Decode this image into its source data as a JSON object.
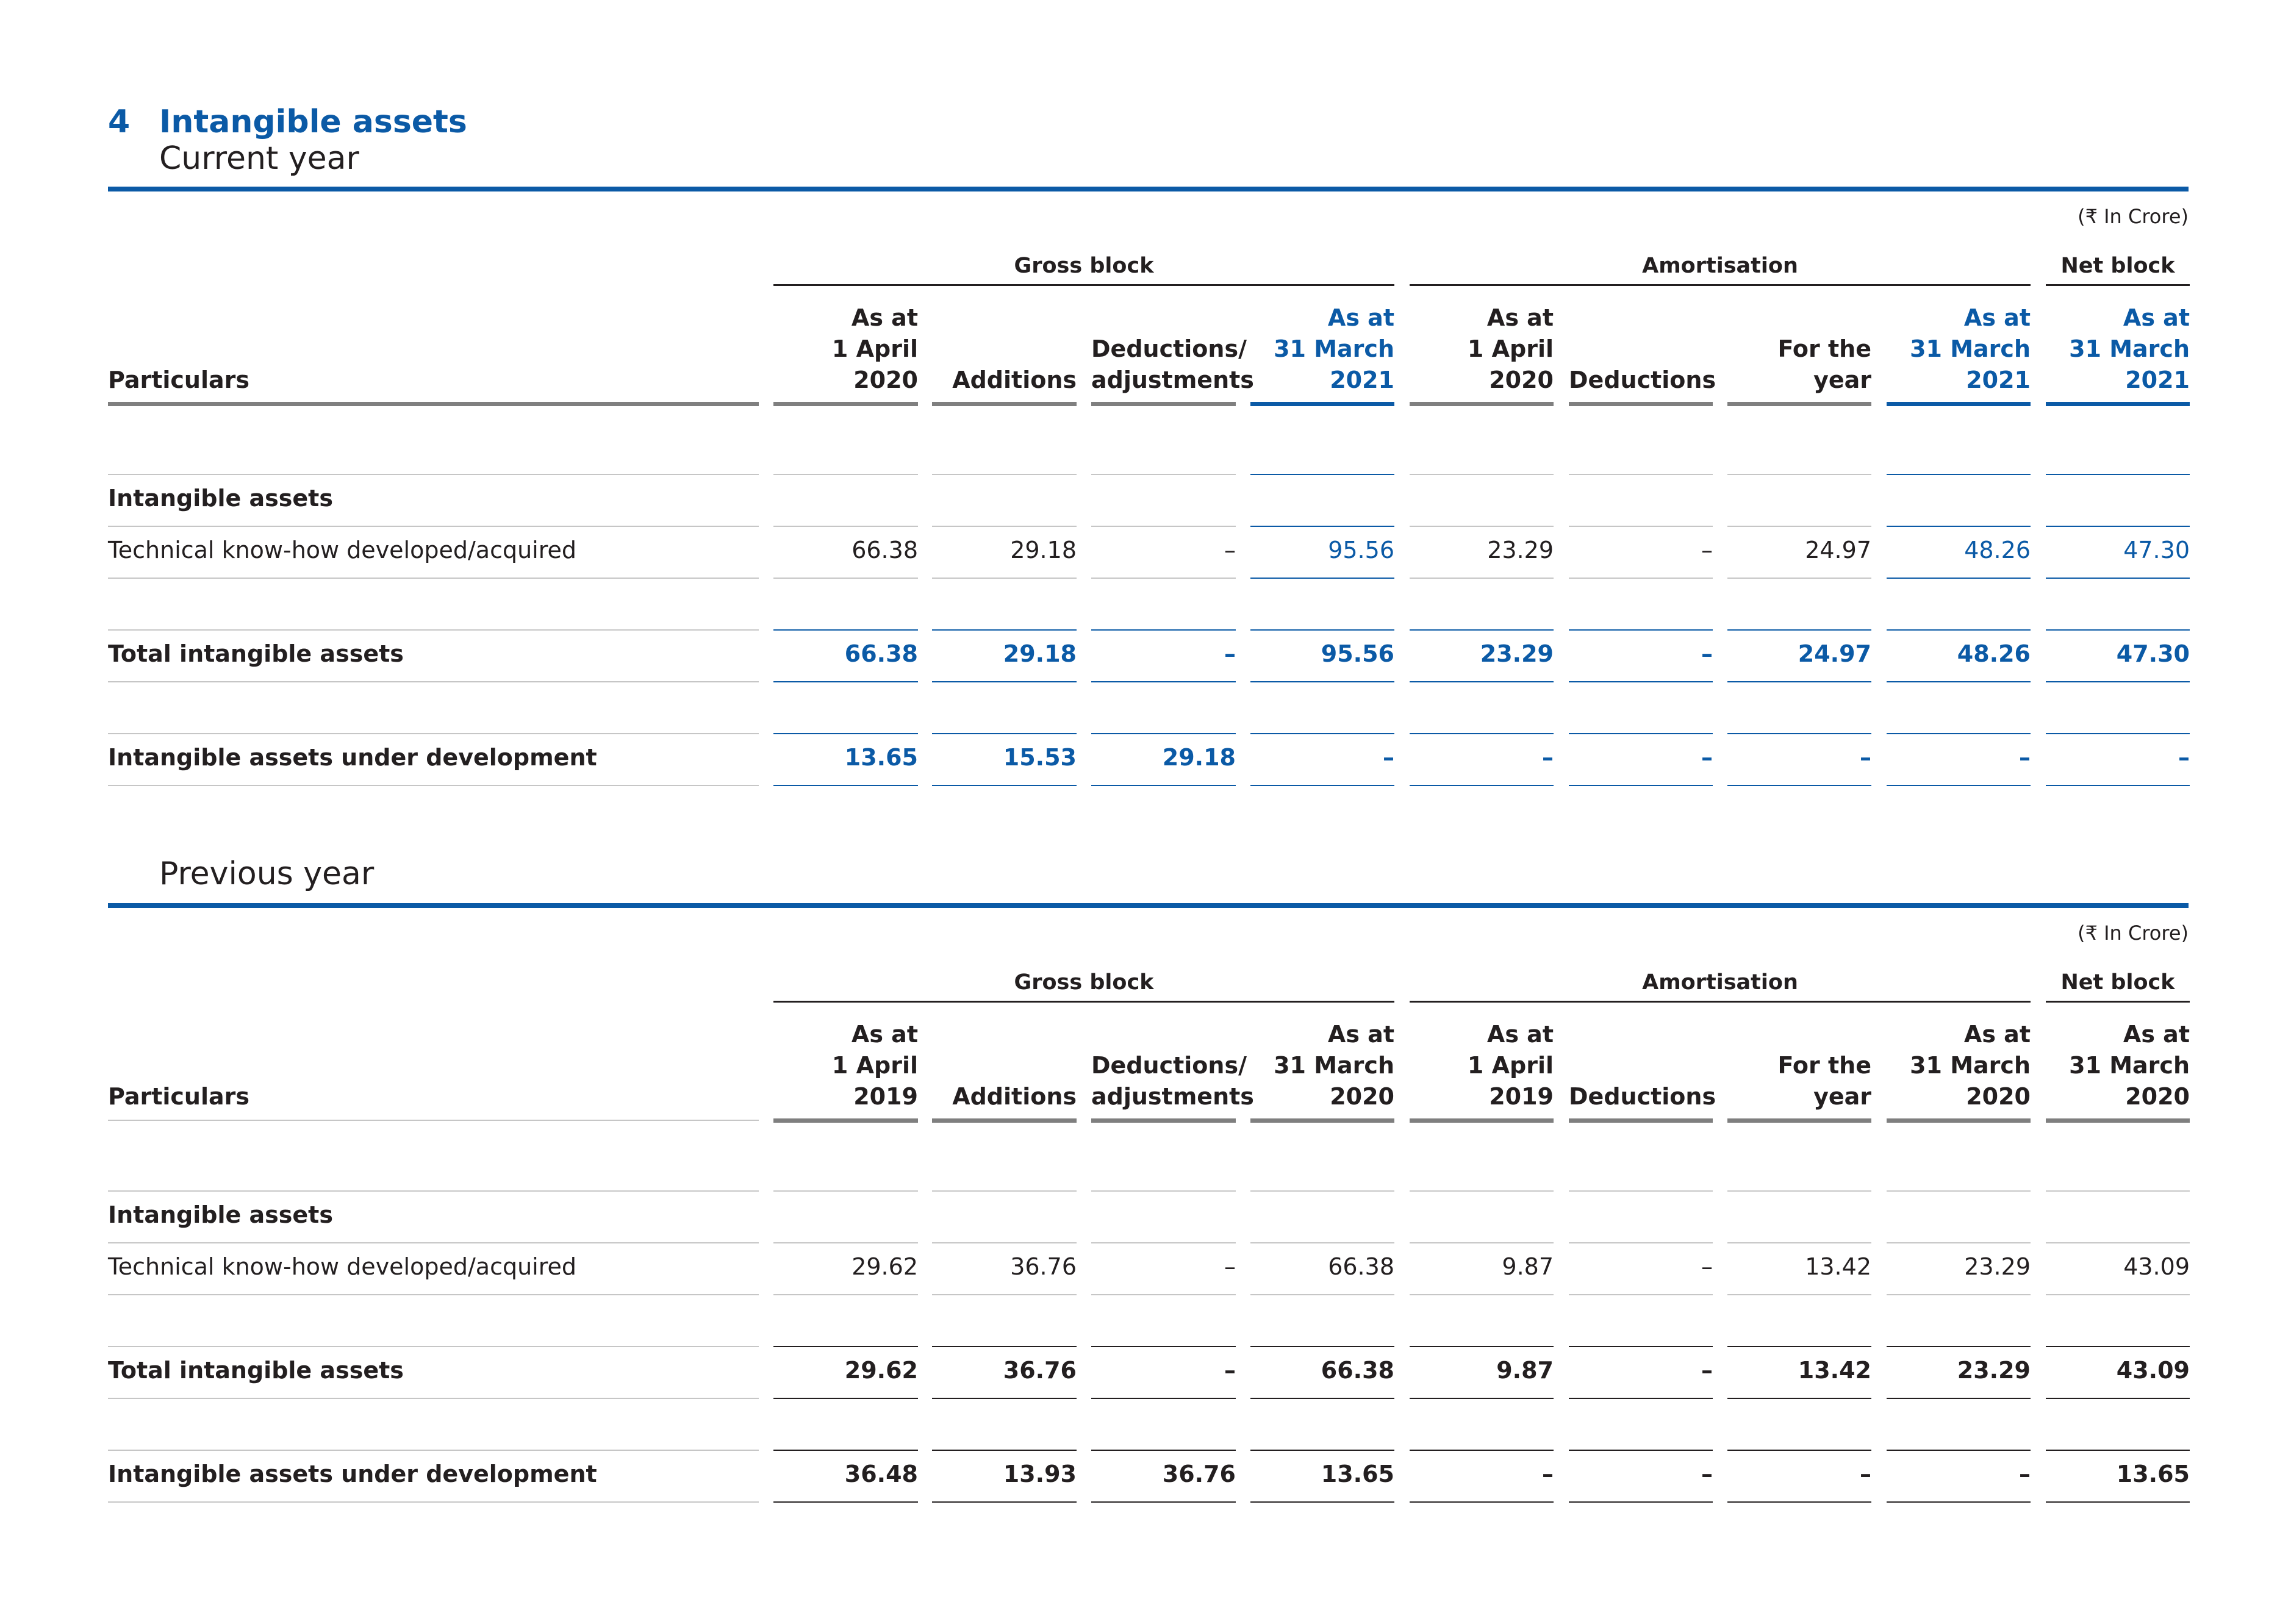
{
  "note": {
    "number": "4",
    "title": "Intangible assets"
  },
  "colors": {
    "accent": "#0b5aa6",
    "text": "#231f20",
    "rule_gray": "#7f7f7f"
  },
  "current_year": {
    "section_title": "Current year",
    "units": "(₹ In Crore)",
    "groups": {
      "gross": "Gross block",
      "amort": "Amortisation",
      "net": "Net block"
    },
    "headers": {
      "particulars": "Particulars",
      "c1": "As at\n1 April\n2020",
      "c2": "Additions",
      "c3": "Deductions/\nadjustments",
      "c4": "As at\n31 March\n2021",
      "c5": "As at\n1 April\n2020",
      "c6": "Deductions",
      "c7": "For the\nyear",
      "c8": "As at\n31 March\n2021",
      "c9": "As at\n31 March\n2021"
    },
    "rows": {
      "heading": {
        "label": "Intangible assets"
      },
      "tech": {
        "label": "Technical know-how developed/acquired",
        "v": [
          "66.38",
          "29.18",
          "–",
          "95.56",
          "23.29",
          "–",
          "24.97",
          "48.26",
          "47.30"
        ]
      },
      "total": {
        "label": "Total intangible assets",
        "v": [
          "66.38",
          "29.18",
          "–",
          "95.56",
          "23.29",
          "–",
          "24.97",
          "48.26",
          "47.30"
        ]
      },
      "dev": {
        "label": "Intangible assets under development",
        "v": [
          "13.65",
          "15.53",
          "29.18",
          "–",
          "–",
          "–",
          "–",
          "–",
          "–"
        ]
      }
    }
  },
  "previous_year": {
    "section_title": "Previous year",
    "units": "(₹ In Crore)",
    "groups": {
      "gross": "Gross block",
      "amort": "Amortisation",
      "net": "Net block"
    },
    "headers": {
      "particulars": "Particulars",
      "c1": "As at\n1 April\n2019",
      "c2": "Additions",
      "c3": "Deductions/\nadjustments",
      "c4": "As at\n31 March\n2020",
      "c5": "As at\n1 April\n2019",
      "c6": "Deductions",
      "c7": "For the\nyear",
      "c8": "As at\n31 March\n2020",
      "c9": "As at\n31 March\n2020"
    },
    "rows": {
      "heading": {
        "label": "Intangible assets"
      },
      "tech": {
        "label": "Technical know-how developed/acquired",
        "v": [
          "29.62",
          "36.76",
          "–",
          "66.38",
          "9.87",
          "–",
          "13.42",
          "23.29",
          "43.09"
        ]
      },
      "total": {
        "label": "Total intangible assets",
        "v": [
          "29.62",
          "36.76",
          "–",
          "66.38",
          "9.87",
          "–",
          "13.42",
          "23.29",
          "43.09"
        ]
      },
      "dev": {
        "label": "Intangible assets under development",
        "v": [
          "36.48",
          "13.93",
          "36.76",
          "13.65",
          "–",
          "–",
          "–",
          "–",
          "13.65"
        ]
      }
    }
  }
}
